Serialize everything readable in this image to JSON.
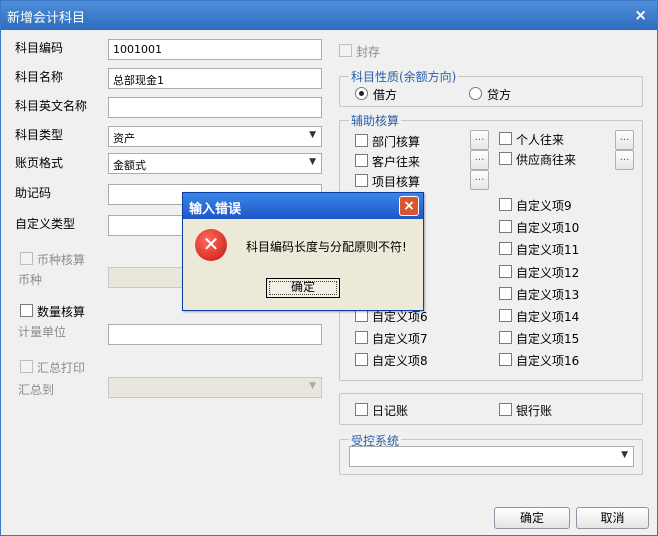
{
  "window": {
    "title": "新增会计科目",
    "close_glyph": "×"
  },
  "form": {
    "code_label": "科目编码",
    "code_value": "1001001",
    "name_label": "科目名称",
    "name_value": "总部现金1",
    "en_name_label": "科目英文名称",
    "en_name_value": "",
    "type_label": "科目类型",
    "type_value": "资产",
    "ledger_label": "账页格式",
    "ledger_value": "金额式",
    "mnemonic_label": "助记码",
    "mnemonic_value": "",
    "custom_type_label": "自定义类型",
    "custom_type_value": "",
    "currency_check_label": "币种核算",
    "currency_label": "币种",
    "currency_value": "",
    "qty_check_label": "数量核算",
    "unit_label": "计量单位",
    "unit_value": "",
    "summary_print_label": "汇总打印",
    "summary_to_label": "汇总到",
    "summary_to_value": ""
  },
  "seal_label": "封存",
  "nature": {
    "title": "科目性质(余额方向)",
    "debit": "借方",
    "credit": "贷方",
    "selected": "debit"
  },
  "aux": {
    "title": "辅助核算",
    "items_left": [
      "部门核算",
      "客户往来",
      "项目核算"
    ],
    "items_right": [
      "个人往来",
      "供应商往来"
    ],
    "custom_left": [
      "自定义项6",
      "自定义项7",
      "自定义项8"
    ],
    "custom_right": [
      "自定义项9",
      "自定义项10",
      "自定义项11",
      "自定义项12",
      "自定义项13",
      "自定义项14",
      "自定义项15",
      "自定义项16"
    ],
    "dots_label": "..."
  },
  "journal": {
    "daily_label": "日记账",
    "bank_label": "银行账"
  },
  "control": {
    "title": "受控系统",
    "value": ""
  },
  "buttons": {
    "ok": "确定",
    "cancel": "取消"
  },
  "dialog": {
    "title": "输入错误",
    "close_glyph": "×",
    "icon_glyph": "✕",
    "message": "科目编码长度与分配原则不符!",
    "ok": "确定"
  },
  "icons": {
    "arrow": "▼"
  }
}
